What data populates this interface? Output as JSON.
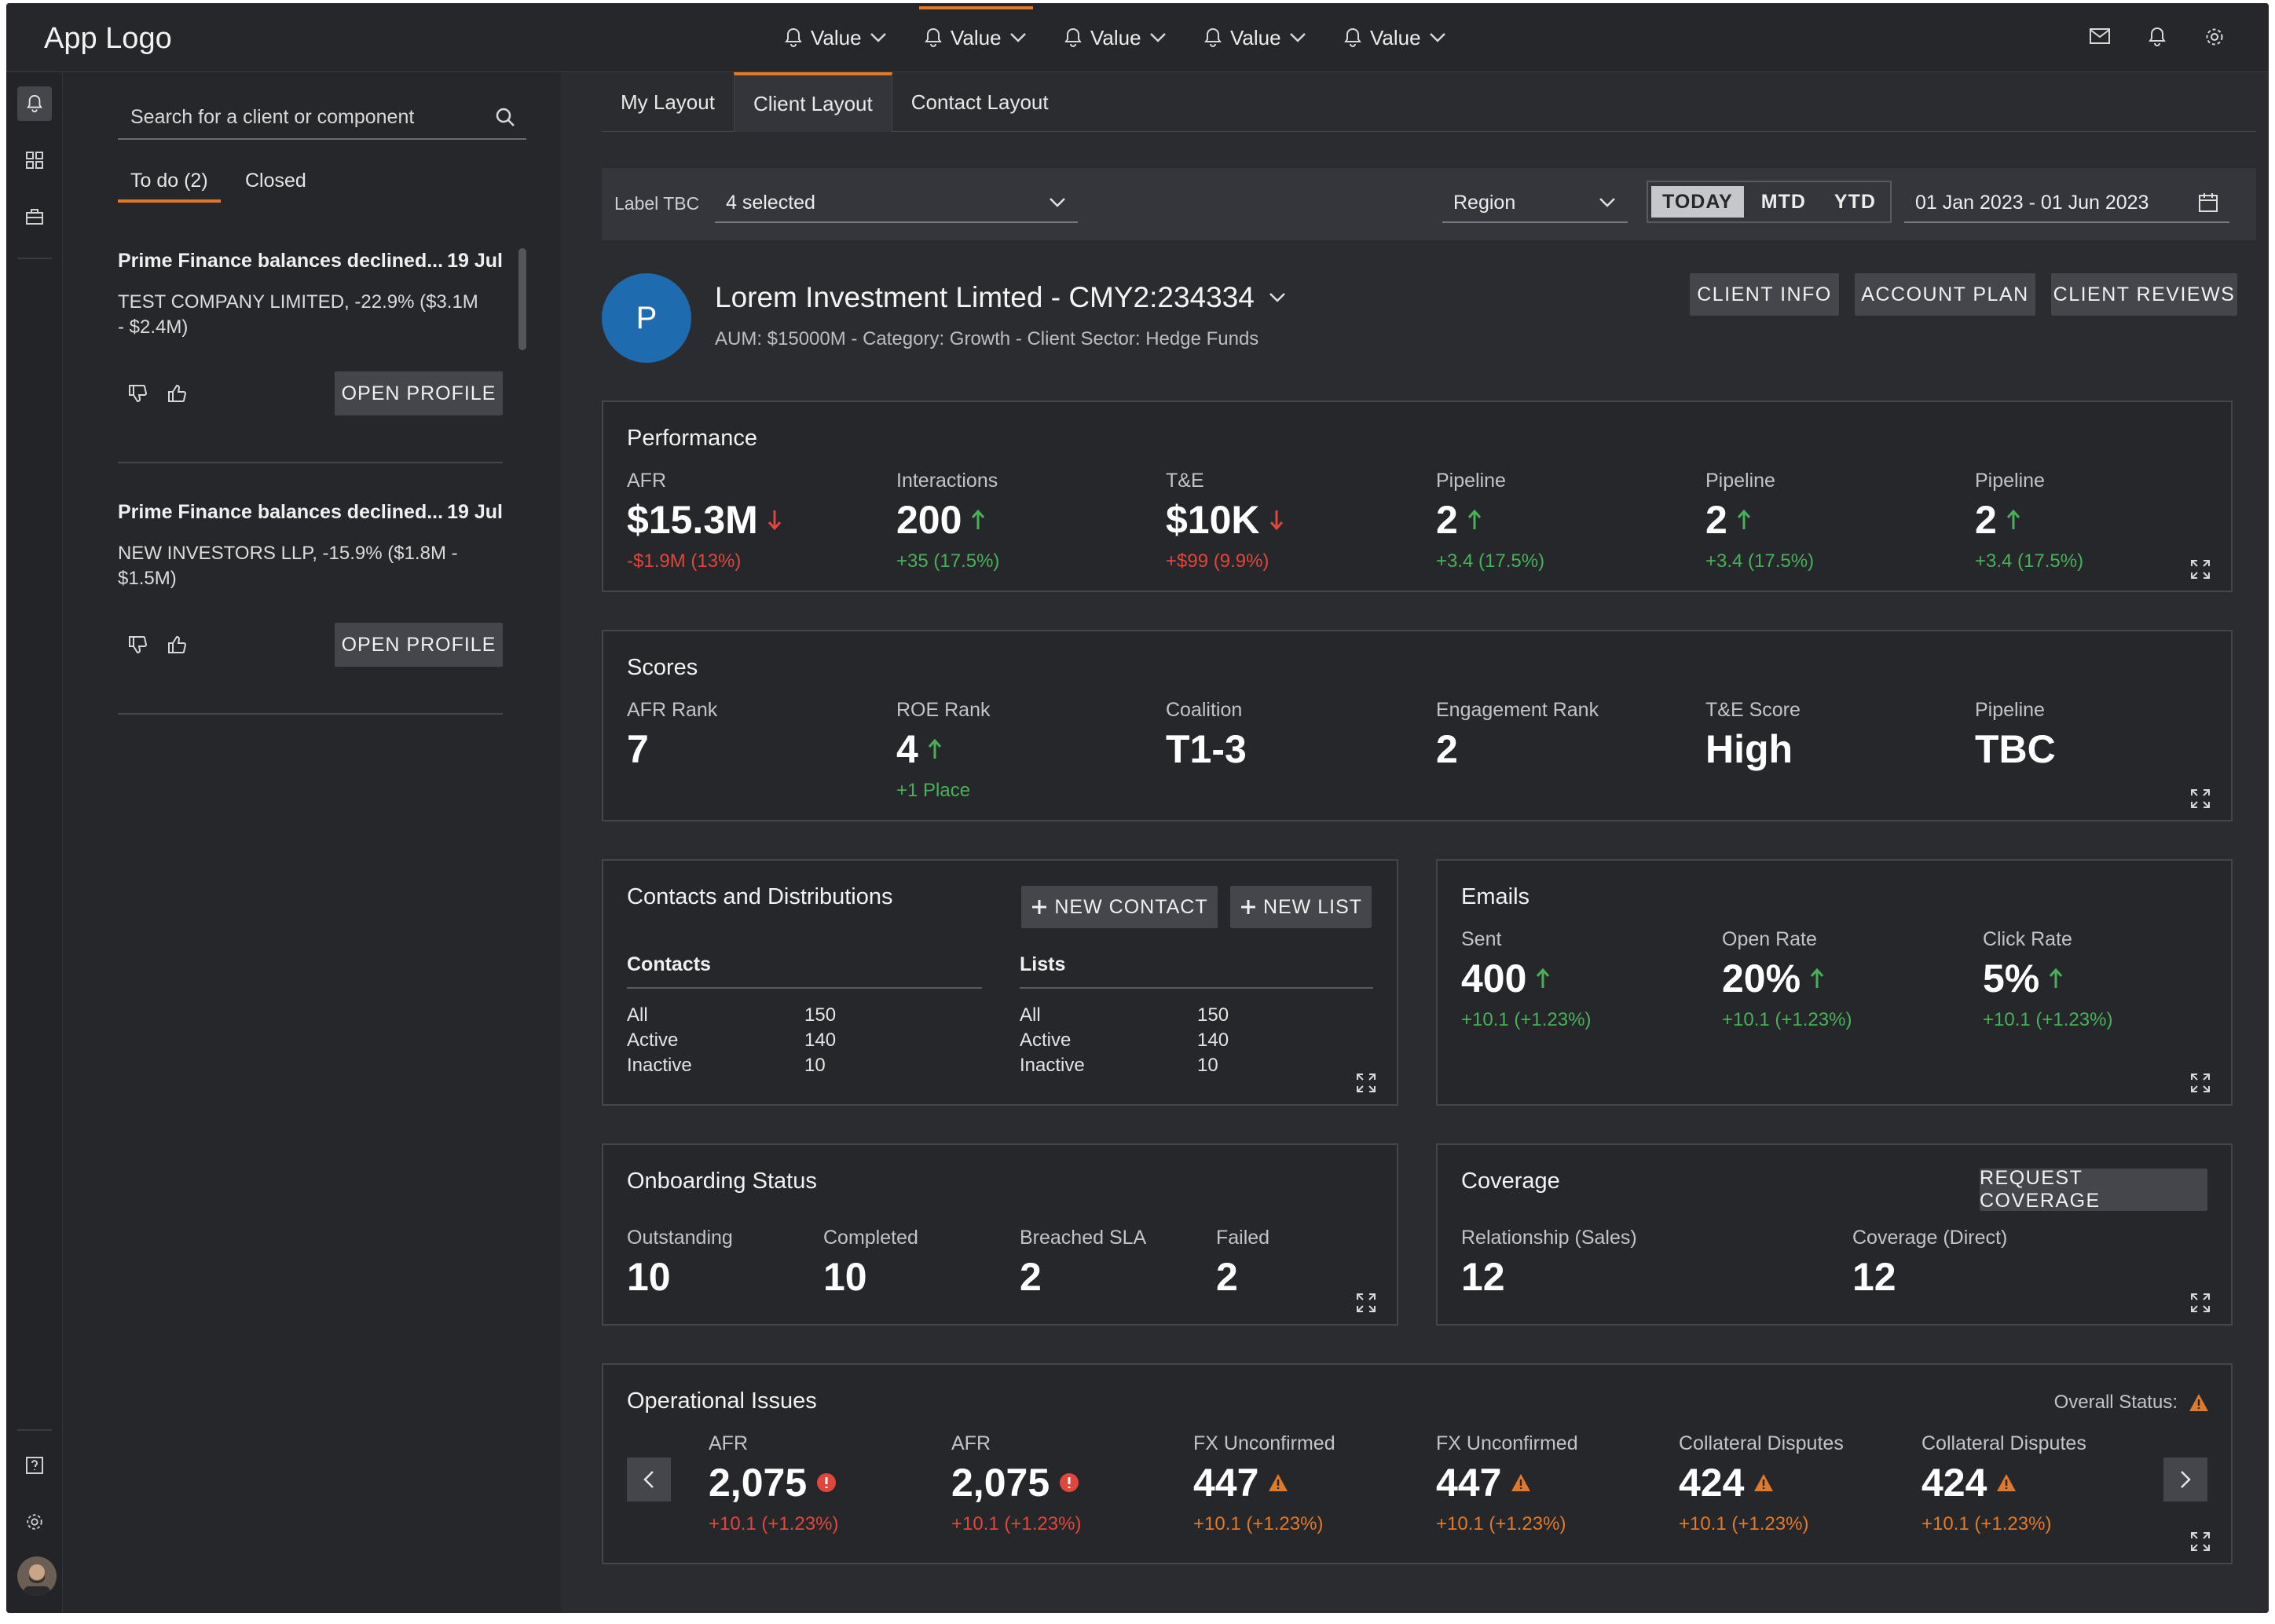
{
  "app": {
    "logo": "App Logo"
  },
  "topbar": {
    "values": [
      "Value",
      "Value",
      "Value",
      "Value",
      "Value"
    ]
  },
  "alerts_panel": {
    "search_placeholder": "Search for a client or component",
    "tabs": [
      "To do (2)",
      "Closed"
    ],
    "alerts": [
      {
        "title": "Prime Finance balances declined...",
        "date": "19 Jul",
        "body": "TEST COMPANY LIMITED, -22.9% ($3.1M - $2.4M)",
        "action": "OPEN PROFILE"
      },
      {
        "title": "Prime Finance balances declined...",
        "date": "19 Jul",
        "body": "NEW INVESTORS LLP, -15.9% ($1.8M - $1.5M)",
        "action": "OPEN PROFILE"
      }
    ]
  },
  "main": {
    "tabs": [
      "My Layout",
      "Client Layout",
      "Contact Layout"
    ],
    "filters": {
      "label": "Label TBC",
      "selected": "4 selected",
      "region": "Region",
      "periods": [
        "TODAY",
        "MTD",
        "YTD"
      ],
      "date_range": "01 Jan 2023 - 01 Jun 2023"
    },
    "client": {
      "initial": "P",
      "name": "Lorem Investment Limted - CMY2:234334",
      "subtitle": "AUM: $15000M - Category: Growth - Client Sector: Hedge Funds",
      "buttons": [
        "CLIENT INFO",
        "ACCOUNT PLAN",
        "CLIENT REVIEWS"
      ]
    },
    "performance": {
      "title": "Performance",
      "metrics": [
        {
          "label": "AFR",
          "value": "$15.3M",
          "delta": "-$1.9M (13%)",
          "trend": "down"
        },
        {
          "label": "Interactions",
          "value": "200",
          "delta": "+35 (17.5%)",
          "trend": "up"
        },
        {
          "label": "T&E",
          "value": "$10K",
          "delta": "+$99 (9.9%)",
          "trend": "down"
        },
        {
          "label": "Pipeline",
          "value": "2",
          "delta": "+3.4 (17.5%)",
          "trend": "up"
        },
        {
          "label": "Pipeline",
          "value": "2",
          "delta": "+3.4 (17.5%)",
          "trend": "up"
        },
        {
          "label": "Pipeline",
          "value": "2",
          "delta": "+3.4 (17.5%)",
          "trend": "up"
        }
      ]
    },
    "scores": {
      "title": "Scores",
      "metrics": [
        {
          "label": "AFR Rank",
          "value": "7"
        },
        {
          "label": "ROE Rank",
          "value": "4",
          "delta": "+1 Place",
          "trend": "up"
        },
        {
          "label": "Coalition",
          "value": "T1-3"
        },
        {
          "label": "Engagement Rank",
          "value": "2"
        },
        {
          "label": "T&E Score",
          "value": "High"
        },
        {
          "label": "Pipeline",
          "value": "TBC"
        }
      ]
    },
    "contacts": {
      "title": "Contacts and Distributions",
      "new_contact": "NEW CONTACT",
      "new_list": "NEW LIST",
      "contacts_header": "Contacts",
      "lists_header": "Lists",
      "contacts_rows": [
        [
          "All",
          "150"
        ],
        [
          "Active",
          "140"
        ],
        [
          "Inactive",
          "10"
        ]
      ],
      "lists_rows": [
        [
          "All",
          "150"
        ],
        [
          "Active",
          "140"
        ],
        [
          "Inactive",
          "10"
        ]
      ]
    },
    "emails": {
      "title": "Emails",
      "metrics": [
        {
          "label": "Sent",
          "value": "400",
          "delta": "+10.1 (+1.23%)"
        },
        {
          "label": "Open Rate",
          "value": "20%",
          "delta": "+10.1 (+1.23%)"
        },
        {
          "label": "Click Rate",
          "value": "5%",
          "delta": "+10.1 (+1.23%)"
        }
      ]
    },
    "onboarding": {
      "title": "Onboarding Status",
      "metrics": [
        {
          "label": "Outstanding",
          "value": "10"
        },
        {
          "label": "Completed",
          "value": "10"
        },
        {
          "label": "Breached SLA",
          "value": "2"
        },
        {
          "label": "Failed",
          "value": "2"
        }
      ]
    },
    "coverage": {
      "title": "Coverage",
      "button": "REQUEST COVERAGE",
      "metrics": [
        {
          "label": "Relationship (Sales)",
          "value": "12"
        },
        {
          "label": "Coverage (Direct)",
          "value": "12"
        }
      ]
    },
    "operational": {
      "title": "Operational Issues",
      "overall_status_label": "Overall Status:",
      "metrics": [
        {
          "label": "AFR",
          "value": "2,075",
          "delta": "+10.1 (+1.23%)",
          "severity": "error"
        },
        {
          "label": "AFR",
          "value": "2,075",
          "delta": "+10.1 (+1.23%)",
          "severity": "error"
        },
        {
          "label": "FX Unconfirmed",
          "value": "447",
          "delta": "+10.1 (+1.23%)",
          "severity": "warning"
        },
        {
          "label": "FX Unconfirmed",
          "value": "447",
          "delta": "+10.1 (+1.23%)",
          "severity": "warning"
        },
        {
          "label": "Collateral Disputes",
          "value": "424",
          "delta": "+10.1 (+1.23%)",
          "severity": "warning"
        },
        {
          "label": "Collateral Disputes",
          "value": "424",
          "delta": "+10.1 (+1.23%)",
          "severity": "warning"
        }
      ]
    }
  },
  "colors": {
    "accent": "#e07a2a",
    "positive": "#49b05a",
    "negative": "#e0463c",
    "error": "#e0463c",
    "warning": "#e07a2a",
    "avatar": "#1e6bb0"
  }
}
